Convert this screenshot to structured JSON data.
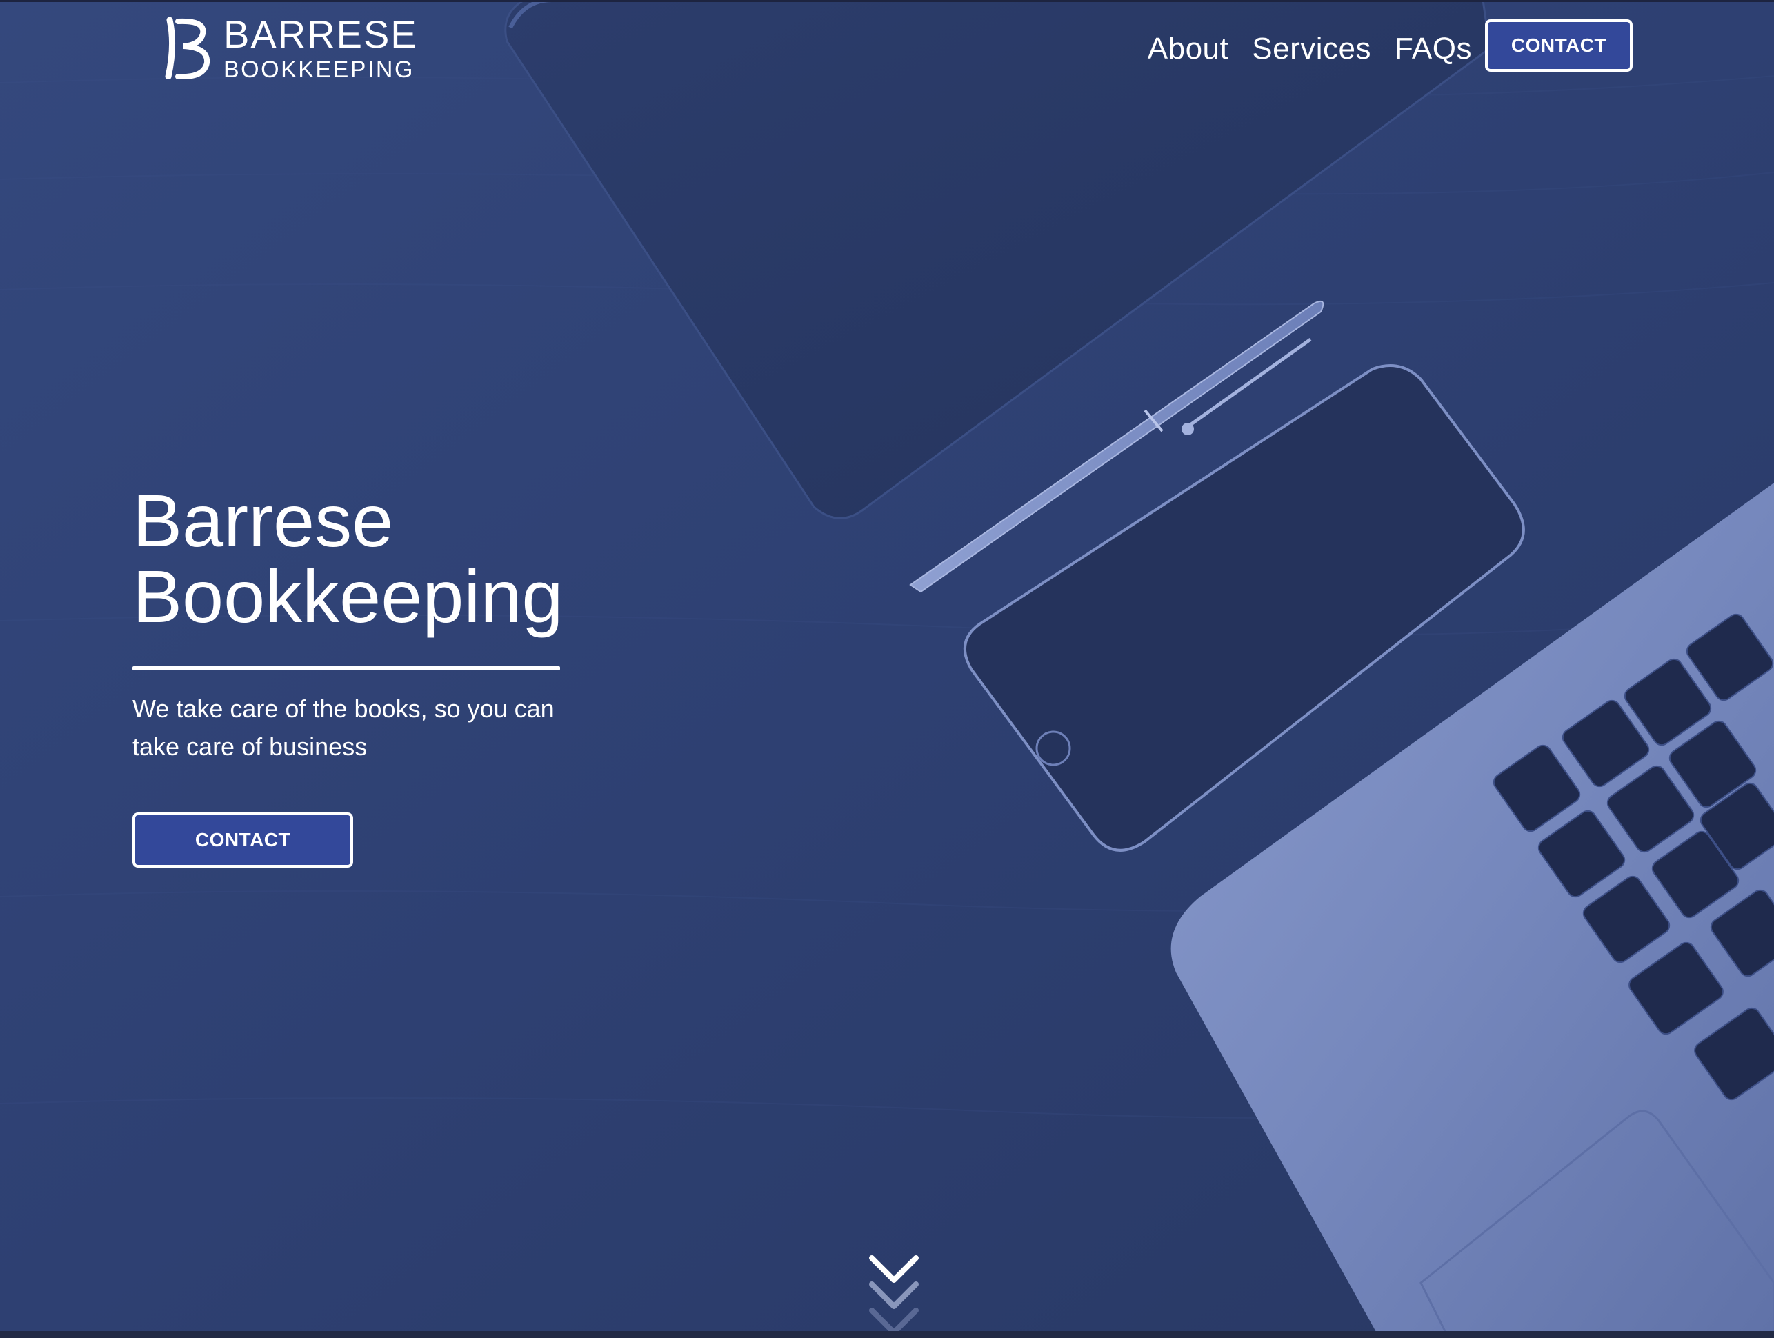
{
  "brand": {
    "logo_initial": "B",
    "name_line1": "BARRESE",
    "name_line2": "BOOKKEEPING"
  },
  "nav": {
    "items": [
      {
        "label": "About"
      },
      {
        "label": "Services"
      },
      {
        "label": "FAQs"
      }
    ],
    "contact_label": "CONTACT"
  },
  "hero": {
    "title_line1": "Barrese",
    "title_line2": "Bookkeeping",
    "subtitle": "We take care of the books, so you can take care of business",
    "contact_label": "CONTACT"
  },
  "icons": {
    "scroll": "chevron-down-icon",
    "logo": "logo-b-icon"
  },
  "colors": {
    "overlay": "#2d3f70",
    "button_fill": "#33489a",
    "text": "#ffffff"
  }
}
